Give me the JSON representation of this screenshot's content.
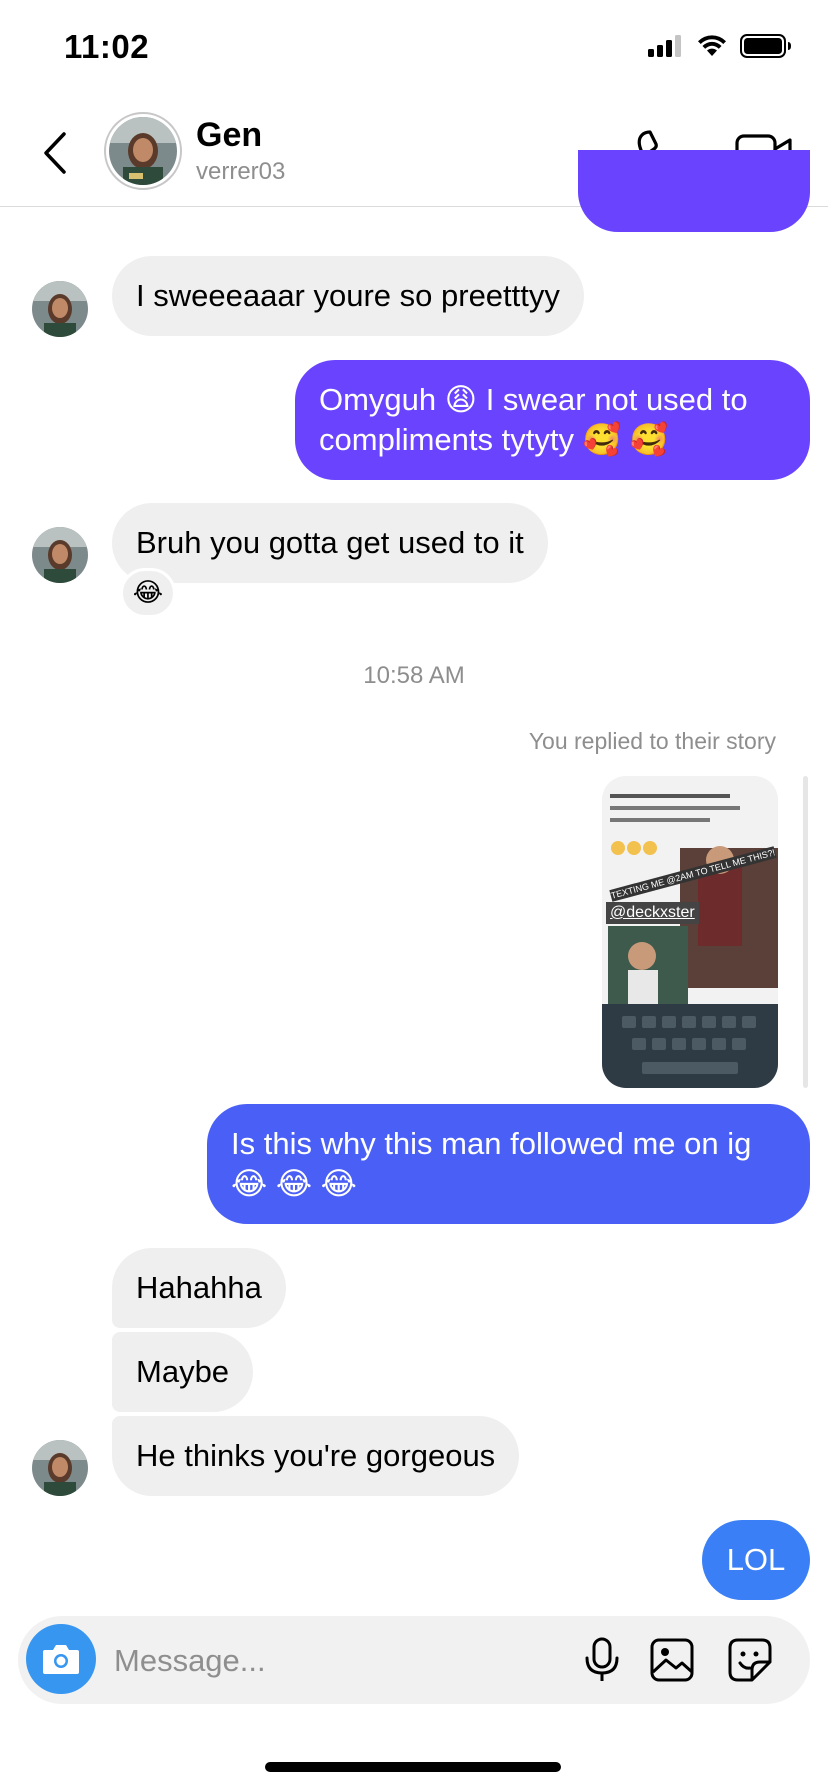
{
  "status_bar": {
    "time": "11:02"
  },
  "header": {
    "name": "Gen",
    "handle": "verrer03"
  },
  "messages": {
    "m1": "I sweeeaaar youre so preetttyy",
    "m2_line1": "Omyguh 😩 I swear not used to",
    "m2_line2": "compliments tytyty 🥰 🥰",
    "m3": "Bruh you gotta get used to it",
    "m3_reaction": "😂",
    "timestamp": "10:58 AM",
    "story_label": "You replied to their story",
    "story_tag": "@deckxster",
    "story_banner": "TEXTING ME @2AM TO TELL ME THIS?!",
    "m4_line1": "Is this why this man followed me on ig",
    "m4_line2": "😂 😂 😂",
    "m5": "Hahahha",
    "m6": "Maybe",
    "m7": "He thinks you're gorgeous",
    "m8": "LOL"
  },
  "composer": {
    "placeholder": "Message..."
  },
  "colors": {
    "outgoing_purple": "#6a43ff",
    "outgoing_indigo": "#4a5ff5",
    "outgoing_blue": "#3a7ff5",
    "incoming_gray": "#efefef",
    "camera_blue": "#3797f0"
  },
  "icons": [
    "back-arrow-icon",
    "phone-icon",
    "video-camera-icon",
    "camera-icon",
    "microphone-icon",
    "image-icon",
    "sticker-icon"
  ]
}
